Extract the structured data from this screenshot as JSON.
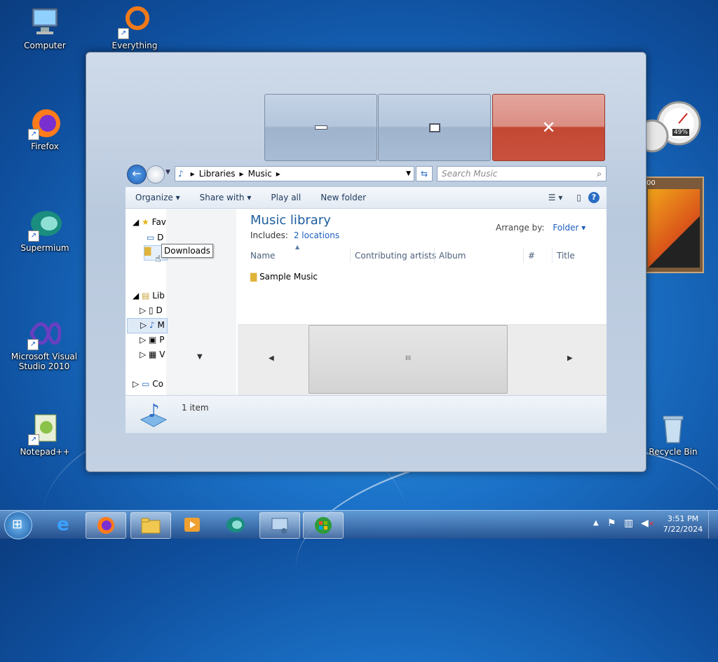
{
  "desktop": {
    "icons": [
      {
        "label": "Computer"
      },
      {
        "label": "Everything"
      },
      {
        "label": "Firefox"
      },
      {
        "label": "Supermium"
      },
      {
        "label": "Microsoft Visual Studio 2010"
      },
      {
        "label": "Notepad++"
      },
      {
        "label": "Recycle Bin"
      }
    ],
    "gadget_meter": "49%",
    "gadget_clock": "00"
  },
  "explorer": {
    "address": [
      "Libraries",
      "Music"
    ],
    "search_placeholder": "Search Music",
    "toolbar": {
      "organize": "Organize",
      "share_with": "Share with",
      "play_all": "Play all",
      "new_folder": "New folder"
    },
    "nav": {
      "favorites": "Fav",
      "desktop": "D",
      "downloads_tooltip": "Downloads",
      "libraries": "Lib",
      "documents": "D",
      "music": "M",
      "pictures": "P",
      "videos": "V",
      "computer": "Co"
    },
    "library": {
      "title": "Music library",
      "includes_label": "Includes:",
      "includes_link": "2 locations",
      "arrange_label": "Arrange by:",
      "arrange_value": "Folder"
    },
    "columns": [
      "Name",
      "Contributing artists",
      "Album",
      "#",
      "Title"
    ],
    "items": [
      {
        "name": "Sample Music"
      }
    ],
    "status": "1 item",
    "scroll_grip": "III"
  },
  "taskbar": {
    "time": "3:51 PM",
    "date": "7/22/2024"
  },
  "colors": {
    "link": "#1c5dbf",
    "title_text": "#1e5e9e",
    "close_red": "#c44834"
  }
}
